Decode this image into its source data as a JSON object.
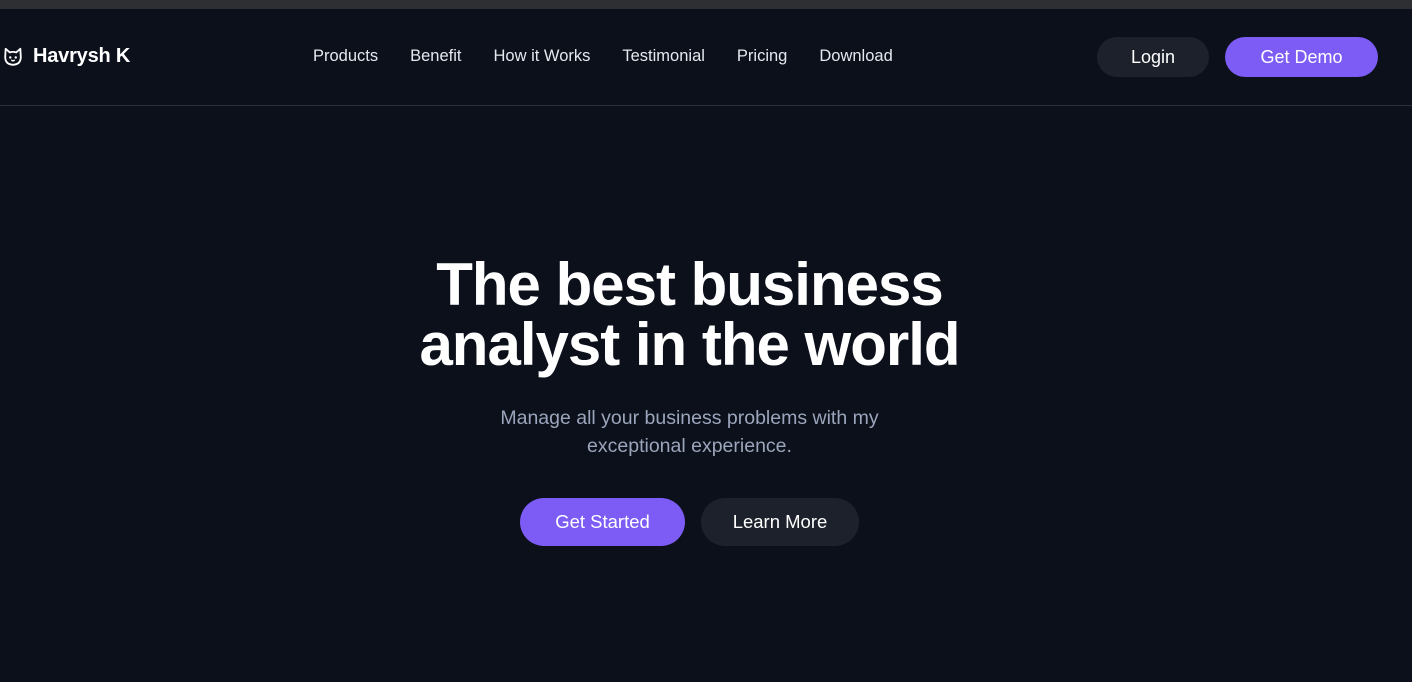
{
  "brand": {
    "name": "Havrysh K",
    "icon": "cat-icon"
  },
  "nav": {
    "links": [
      "Products",
      "Benefit",
      "How it Works",
      "Testimonial",
      "Pricing",
      "Download"
    ]
  },
  "header_actions": {
    "login_label": "Login",
    "demo_label": "Get Demo"
  },
  "hero": {
    "title_line1": "The best business",
    "title_line2": "analyst in the world",
    "subtitle_line1": "Manage all your business problems with my",
    "subtitle_line2": "exceptional experience.",
    "primary_cta": "Get Started",
    "secondary_cta": "Learn More"
  },
  "colors": {
    "background": "#0b101b",
    "accent": "#7c5cf5",
    "secondary_button": "#1d212b",
    "muted_text": "#9ba5bb"
  }
}
